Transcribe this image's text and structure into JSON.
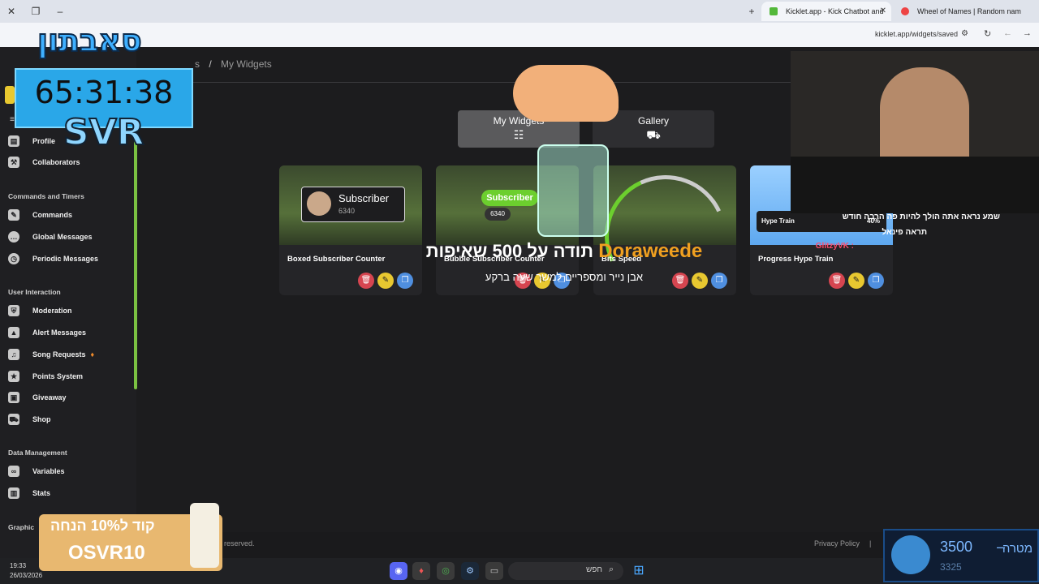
{
  "browser": {
    "tabs": [
      {
        "title": "Kicklet.app - Kick Chatbot and",
        "active": true
      },
      {
        "title": "Wheel of Names | Random nam",
        "active": false
      }
    ],
    "new_tab": "+",
    "url": "kicklet.app/widgets/saved"
  },
  "breadcrumb": {
    "prev": "s",
    "sep": "/",
    "current": "My Widgets"
  },
  "sidebar": {
    "top_items": [
      {
        "label": "Profile",
        "icon": "profile-icon"
      },
      {
        "label": "Collaborators",
        "icon": "collaborators-icon"
      }
    ],
    "sections": [
      {
        "title": "Commands and Timers",
        "items": [
          {
            "label": "Commands",
            "icon": "wrench-icon"
          },
          {
            "label": "Global Messages",
            "icon": "chat-icon"
          },
          {
            "label": "Periodic Messages",
            "icon": "clock-icon"
          }
        ]
      },
      {
        "title": "User Interaction",
        "items": [
          {
            "label": "Moderation",
            "icon": "shield-icon"
          },
          {
            "label": "Alert Messages",
            "icon": "warning-icon"
          },
          {
            "label": "Song Requests",
            "icon": "music-icon"
          },
          {
            "label": "Points System",
            "icon": "star-icon"
          },
          {
            "label": "Giveaway",
            "icon": "gift-icon"
          },
          {
            "label": "Shop",
            "icon": "cart-icon"
          }
        ]
      },
      {
        "title": "Data Management",
        "items": [
          {
            "label": "Variables",
            "icon": "link-icon"
          },
          {
            "label": "Stats",
            "icon": "chart-icon"
          }
        ]
      }
    ],
    "bottom_section": "Graphic"
  },
  "toggles": [
    {
      "label": "My Widgets",
      "icon": "database-icon",
      "active": true
    },
    {
      "label": "Gallery",
      "icon": "cart-icon",
      "active": false
    }
  ],
  "widgets": [
    {
      "title": "Boxed Subscriber Counter",
      "preview_label": "Subscriber",
      "preview_count": "6340"
    },
    {
      "title": "Bubble Subscriber Counter",
      "preview_label": "Subscriber",
      "preview_count": "6340"
    },
    {
      "title": "Bits Speed"
    },
    {
      "title": "Progress Hype Train",
      "preview_label": "Hype Train",
      "preview_pct": "40%"
    }
  ],
  "footer": {
    "rights": "reserved.",
    "privacy": "Privacy Policy",
    "sep": "|"
  },
  "taskbar": {
    "time": "19:33",
    "date": "26/03/2026",
    "search_placeholder": "חפש"
  },
  "overlay": {
    "channel_logo": "סאבתון",
    "timer": "65:31:38",
    "streamer_tag": "SVR",
    "donation_line": "תודה על 500 שאיפות",
    "donation_user": "Doraweede",
    "donation_sub": "אבן נייר ומספריים למשך שעה ברקע",
    "chat_lines": [
      "שמע נראה אתה הולך להיות פה הרבה חודש",
      "תראה פינאל",
      "GlitzyVK :"
    ],
    "goal_label": "מטרה",
    "goal_value": "3500",
    "goal_current": "3325",
    "promo_text": "קוד ל10% הנחה",
    "promo_code": "OSVR10"
  }
}
